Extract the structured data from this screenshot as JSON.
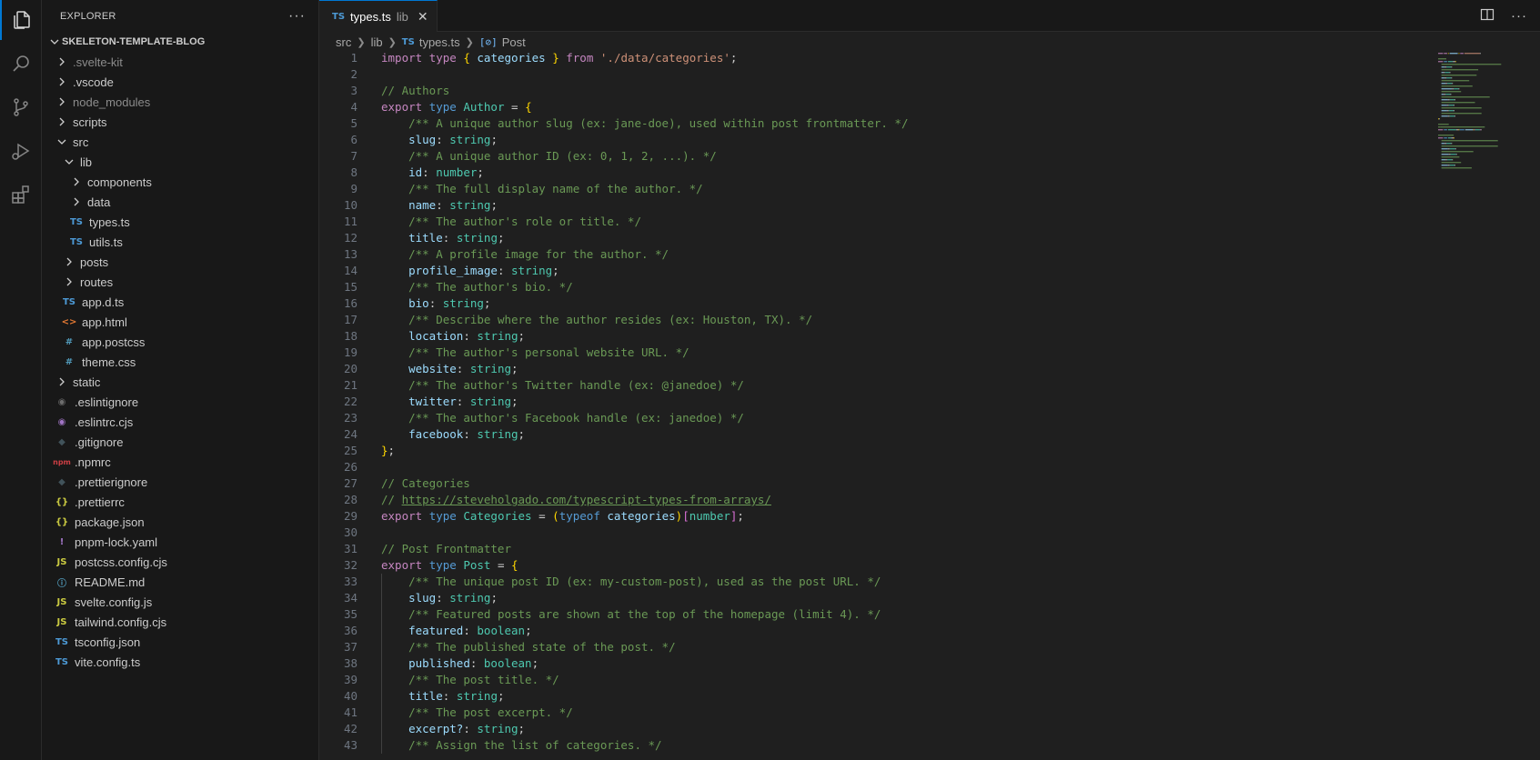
{
  "explorer": {
    "title": "EXPLORER",
    "more": "···",
    "root": "SKELETON-TEMPLATE-BLOG",
    "items": [
      {
        "label": ".svelte-kit",
        "type": "folder",
        "open": false,
        "depth": 0,
        "dim": true
      },
      {
        "label": ".vscode",
        "type": "folder",
        "open": false,
        "depth": 0
      },
      {
        "label": "node_modules",
        "type": "folder",
        "open": false,
        "depth": 0,
        "dim": true
      },
      {
        "label": "scripts",
        "type": "folder",
        "open": false,
        "depth": 0
      },
      {
        "label": "src",
        "type": "folder",
        "open": true,
        "depth": 0
      },
      {
        "label": "lib",
        "type": "folder",
        "open": true,
        "depth": 1
      },
      {
        "label": "components",
        "type": "folder",
        "open": false,
        "depth": 2
      },
      {
        "label": "data",
        "type": "folder",
        "open": false,
        "depth": 2
      },
      {
        "label": "types.ts",
        "type": "file",
        "icon": "TS",
        "iconColor": "#4d9ad6",
        "depth": 2
      },
      {
        "label": "utils.ts",
        "type": "file",
        "icon": "TS",
        "iconColor": "#4d9ad6",
        "depth": 2
      },
      {
        "label": "posts",
        "type": "folder",
        "open": false,
        "depth": 1
      },
      {
        "label": "routes",
        "type": "folder",
        "open": false,
        "depth": 1
      },
      {
        "label": "app.d.ts",
        "type": "file",
        "icon": "TS",
        "iconColor": "#4d9ad6",
        "depth": 1
      },
      {
        "label": "app.html",
        "type": "file",
        "icon": "<>",
        "iconColor": "#e37933",
        "depth": 1
      },
      {
        "label": "app.postcss",
        "type": "file",
        "icon": "#",
        "iconColor": "#519aba",
        "depth": 1
      },
      {
        "label": "theme.css",
        "type": "file",
        "icon": "#",
        "iconColor": "#519aba",
        "depth": 1
      },
      {
        "label": "static",
        "type": "folder",
        "open": false,
        "depth": 0
      },
      {
        "label": ".eslintignore",
        "type": "file",
        "icon": "◉",
        "iconColor": "#6d6d6d",
        "depth": 0
      },
      {
        "label": ".eslintrc.cjs",
        "type": "file",
        "icon": "◉",
        "iconColor": "#a074c4",
        "depth": 0
      },
      {
        "label": ".gitignore",
        "type": "file",
        "icon": "◆",
        "iconColor": "#41535b",
        "depth": 0
      },
      {
        "label": ".npmrc",
        "type": "file",
        "icon": "npm",
        "iconColor": "#cc3e44",
        "depth": 0
      },
      {
        "label": ".prettierignore",
        "type": "file",
        "icon": "◆",
        "iconColor": "#41535b",
        "depth": 0
      },
      {
        "label": ".prettierrc",
        "type": "file",
        "icon": "{}",
        "iconColor": "#cbcb41",
        "depth": 0
      },
      {
        "label": "package.json",
        "type": "file",
        "icon": "{}",
        "iconColor": "#cbcb41",
        "depth": 0
      },
      {
        "label": "pnpm-lock.yaml",
        "type": "file",
        "icon": "!",
        "iconColor": "#a074c4",
        "depth": 0
      },
      {
        "label": "postcss.config.cjs",
        "type": "file",
        "icon": "JS",
        "iconColor": "#cbcb41",
        "depth": 0
      },
      {
        "label": "README.md",
        "type": "file",
        "icon": "ⓘ",
        "iconColor": "#519aba",
        "depth": 0
      },
      {
        "label": "svelte.config.js",
        "type": "file",
        "icon": "JS",
        "iconColor": "#cbcb41",
        "depth": 0
      },
      {
        "label": "tailwind.config.cjs",
        "type": "file",
        "icon": "JS",
        "iconColor": "#cbcb41",
        "depth": 0
      },
      {
        "label": "tsconfig.json",
        "type": "file",
        "icon": "TS",
        "iconColor": "#4d9ad6",
        "depth": 0
      },
      {
        "label": "vite.config.ts",
        "type": "file",
        "icon": "TS",
        "iconColor": "#4d9ad6",
        "depth": 0
      }
    ]
  },
  "tab": {
    "icon": "TS",
    "name": "types.ts",
    "desc": "lib",
    "close": "✕"
  },
  "breadcrumb": {
    "parts": [
      "src",
      "lib"
    ],
    "file_icon": "TS",
    "file": "types.ts",
    "symbol_icon": "[⊘]",
    "symbol": "Post"
  },
  "code": {
    "lines": [
      [
        [
          "kw",
          "import"
        ],
        [
          "pn",
          " "
        ],
        [
          "kw",
          "type"
        ],
        [
          "pn",
          " "
        ],
        [
          "br1",
          "{"
        ],
        [
          "pn",
          " "
        ],
        [
          "prop",
          "categories"
        ],
        [
          "pn",
          " "
        ],
        [
          "br1",
          "}"
        ],
        [
          "pn",
          " "
        ],
        [
          "kw",
          "from"
        ],
        [
          "pn",
          " "
        ],
        [
          "str",
          "'./data/categories'"
        ],
        [
          "pn",
          ";"
        ]
      ],
      [],
      [
        [
          "cm",
          "// Authors"
        ]
      ],
      [
        [
          "kw",
          "export"
        ],
        [
          "pn",
          " "
        ],
        [
          "kw2",
          "type"
        ],
        [
          "pn",
          " "
        ],
        [
          "ty",
          "Author"
        ],
        [
          "pn",
          " = "
        ],
        [
          "br1",
          "{"
        ]
      ],
      [
        [
          "pn",
          "    "
        ],
        [
          "cm",
          "/** A unique author slug (ex: jane-doe), used within post frontmatter. */"
        ]
      ],
      [
        [
          "pn",
          "    "
        ],
        [
          "prop",
          "slug"
        ],
        [
          "pn",
          ": "
        ],
        [
          "ty",
          "string"
        ],
        [
          "pn",
          ";"
        ]
      ],
      [
        [
          "pn",
          "    "
        ],
        [
          "cm",
          "/** A unique author ID (ex: 0, 1, 2, ...). */"
        ]
      ],
      [
        [
          "pn",
          "    "
        ],
        [
          "prop",
          "id"
        ],
        [
          "pn",
          ": "
        ],
        [
          "ty",
          "number"
        ],
        [
          "pn",
          ";"
        ]
      ],
      [
        [
          "pn",
          "    "
        ],
        [
          "cm",
          "/** The full display name of the author. */"
        ]
      ],
      [
        [
          "pn",
          "    "
        ],
        [
          "prop",
          "name"
        ],
        [
          "pn",
          ": "
        ],
        [
          "ty",
          "string"
        ],
        [
          "pn",
          ";"
        ]
      ],
      [
        [
          "pn",
          "    "
        ],
        [
          "cm",
          "/** The author's role or title. */"
        ]
      ],
      [
        [
          "pn",
          "    "
        ],
        [
          "prop",
          "title"
        ],
        [
          "pn",
          ": "
        ],
        [
          "ty",
          "string"
        ],
        [
          "pn",
          ";"
        ]
      ],
      [
        [
          "pn",
          "    "
        ],
        [
          "cm",
          "/** A profile image for the author. */"
        ]
      ],
      [
        [
          "pn",
          "    "
        ],
        [
          "prop",
          "profile_image"
        ],
        [
          "pn",
          ": "
        ],
        [
          "ty",
          "string"
        ],
        [
          "pn",
          ";"
        ]
      ],
      [
        [
          "pn",
          "    "
        ],
        [
          "cm",
          "/** The author's bio. */"
        ]
      ],
      [
        [
          "pn",
          "    "
        ],
        [
          "prop",
          "bio"
        ],
        [
          "pn",
          ": "
        ],
        [
          "ty",
          "string"
        ],
        [
          "pn",
          ";"
        ]
      ],
      [
        [
          "pn",
          "    "
        ],
        [
          "cm",
          "/** Describe where the author resides (ex: Houston, TX). */"
        ]
      ],
      [
        [
          "pn",
          "    "
        ],
        [
          "prop",
          "location"
        ],
        [
          "pn",
          ": "
        ],
        [
          "ty",
          "string"
        ],
        [
          "pn",
          ";"
        ]
      ],
      [
        [
          "pn",
          "    "
        ],
        [
          "cm",
          "/** The author's personal website URL. */"
        ]
      ],
      [
        [
          "pn",
          "    "
        ],
        [
          "prop",
          "website"
        ],
        [
          "pn",
          ": "
        ],
        [
          "ty",
          "string"
        ],
        [
          "pn",
          ";"
        ]
      ],
      [
        [
          "pn",
          "    "
        ],
        [
          "cm",
          "/** The author's Twitter handle (ex: @janedoe) */"
        ]
      ],
      [
        [
          "pn",
          "    "
        ],
        [
          "prop",
          "twitter"
        ],
        [
          "pn",
          ": "
        ],
        [
          "ty",
          "string"
        ],
        [
          "pn",
          ";"
        ]
      ],
      [
        [
          "pn",
          "    "
        ],
        [
          "cm",
          "/** The author's Facebook handle (ex: janedoe) */"
        ]
      ],
      [
        [
          "pn",
          "    "
        ],
        [
          "prop",
          "facebook"
        ],
        [
          "pn",
          ": "
        ],
        [
          "ty",
          "string"
        ],
        [
          "pn",
          ";"
        ]
      ],
      [
        [
          "br1",
          "}"
        ],
        [
          "pn",
          ";"
        ]
      ],
      [],
      [
        [
          "cm",
          "// Categories"
        ]
      ],
      [
        [
          "cm",
          "// "
        ],
        [
          "lnk",
          "https://steveholgado.com/typescript-types-from-arrays/"
        ]
      ],
      [
        [
          "kw",
          "export"
        ],
        [
          "pn",
          " "
        ],
        [
          "kw2",
          "type"
        ],
        [
          "pn",
          " "
        ],
        [
          "ty",
          "Categories"
        ],
        [
          "pn",
          " = "
        ],
        [
          "br1",
          "("
        ],
        [
          "kw2",
          "typeof"
        ],
        [
          "pn",
          " "
        ],
        [
          "prop",
          "categories"
        ],
        [
          "br1",
          ")"
        ],
        [
          "br2",
          "["
        ],
        [
          "ty",
          "number"
        ],
        [
          "br2",
          "]"
        ],
        [
          "pn",
          ";"
        ]
      ],
      [],
      [
        [
          "cm",
          "// Post Frontmatter"
        ]
      ],
      [
        [
          "kw",
          "export"
        ],
        [
          "pn",
          " "
        ],
        [
          "kw2",
          "type"
        ],
        [
          "pn",
          " "
        ],
        [
          "ty",
          "Post"
        ],
        [
          "pn",
          " = "
        ],
        [
          "br1",
          "{"
        ]
      ],
      [
        [
          "pn",
          "    "
        ],
        [
          "cm",
          "/** The unique post ID (ex: my-custom-post), used as the post URL. */"
        ]
      ],
      [
        [
          "pn",
          "    "
        ],
        [
          "prop",
          "slug"
        ],
        [
          "pn",
          ": "
        ],
        [
          "ty",
          "string"
        ],
        [
          "pn",
          ";"
        ]
      ],
      [
        [
          "pn",
          "    "
        ],
        [
          "cm",
          "/** Featured posts are shown at the top of the homepage (limit 4). */"
        ]
      ],
      [
        [
          "pn",
          "    "
        ],
        [
          "prop",
          "featured"
        ],
        [
          "pn",
          ": "
        ],
        [
          "ty",
          "boolean"
        ],
        [
          "pn",
          ";"
        ]
      ],
      [
        [
          "pn",
          "    "
        ],
        [
          "cm",
          "/** The published state of the post. */"
        ]
      ],
      [
        [
          "pn",
          "    "
        ],
        [
          "prop",
          "published"
        ],
        [
          "pn",
          ": "
        ],
        [
          "ty",
          "boolean"
        ],
        [
          "pn",
          ";"
        ]
      ],
      [
        [
          "pn",
          "    "
        ],
        [
          "cm",
          "/** The post title. */"
        ]
      ],
      [
        [
          "pn",
          "    "
        ],
        [
          "prop",
          "title"
        ],
        [
          "pn",
          ": "
        ],
        [
          "ty",
          "string"
        ],
        [
          "pn",
          ";"
        ]
      ],
      [
        [
          "pn",
          "    "
        ],
        [
          "cm",
          "/** The post excerpt. */"
        ]
      ],
      [
        [
          "pn",
          "    "
        ],
        [
          "prop",
          "excerpt?"
        ],
        [
          "pn",
          ": "
        ],
        [
          "ty",
          "string"
        ],
        [
          "pn",
          ";"
        ]
      ],
      [
        [
          "pn",
          "    "
        ],
        [
          "cm",
          "/** Assign the list of categories. */"
        ]
      ]
    ]
  },
  "colors": {
    "accent": "#0078d4",
    "bg": "#1f1f1f",
    "sidebar": "#181818"
  }
}
